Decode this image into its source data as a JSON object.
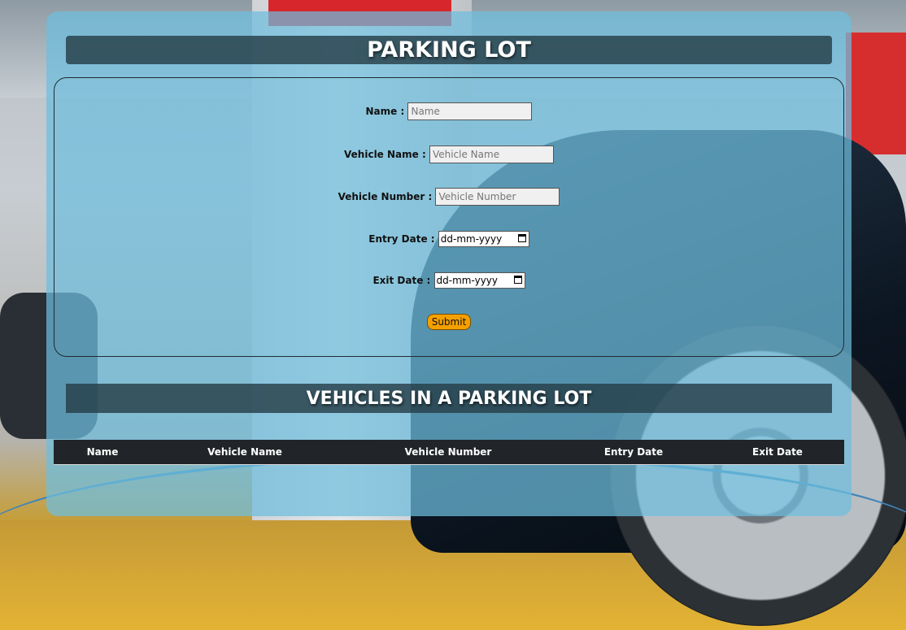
{
  "header": {
    "title": "PARKING LOT"
  },
  "form": {
    "name": {
      "label": "Name :",
      "placeholder": "Name"
    },
    "vehicle_name": {
      "label": "Vehicle Name :",
      "placeholder": "Vehicle Name"
    },
    "vehicle_number": {
      "label": "Vehicle Number :",
      "placeholder": "Vehicle Number"
    },
    "entry_date": {
      "label": "Entry Date :",
      "value": "dd-mm-yyyy"
    },
    "exit_date": {
      "label": "Exit Date :",
      "value": "dd-mm-yyyy"
    },
    "submit_label": "Submit"
  },
  "list": {
    "title": "VEHICLES IN A PARKING LOT",
    "columns": [
      "Name",
      "Vehicle Name",
      "Vehicle Number",
      "Entry Date",
      "Exit Date"
    ]
  },
  "icons": {
    "date_picker": "calendar-icon"
  },
  "colors": {
    "submit_button": "#f5a000",
    "table_header": "#212529"
  }
}
